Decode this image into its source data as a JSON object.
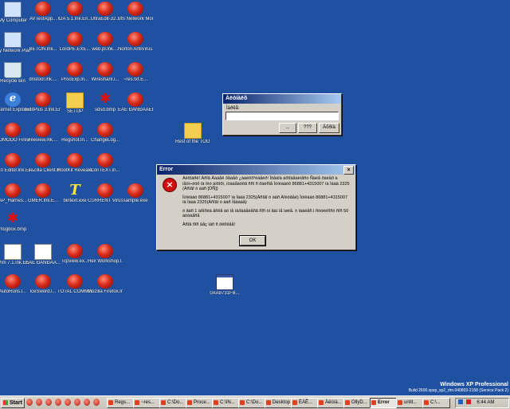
{
  "desktop": {
    "watermark": {
      "line1": "Windows XP Professional",
      "line2": "Build 2600.xpsp_sp2_rtm.040803-2158 (Service Pack 2)"
    },
    "icons": [
      {
        "name": "my-computer",
        "icon": "monitor",
        "label": "My Computer"
      },
      {
        "name": "avtestapp",
        "icon": "bug",
        "label": "AVTestApp..."
      },
      {
        "name": "ida",
        "icon": "bug",
        "label": "IDA 5.1.lnk.En..."
      },
      {
        "name": "ultraedit",
        "icon": "bug",
        "label": "UltraEdit-32..."
      },
      {
        "name": "network-monitor",
        "icon": "bug",
        "label": "MS Network Monitor 3...."
      },
      {
        "name": "my-network-places",
        "icon": "monitor",
        "label": "My Network Places"
      },
      {
        "name": "beton",
        "icon": "bug",
        "label": "BETON.lnk..."
      },
      {
        "name": "lordpe",
        "icon": "bug",
        "label": "LordPE.EXE..."
      },
      {
        "name": "webpl",
        "icon": "bug",
        "label": "web.pl.lnk...."
      },
      {
        "name": "norton",
        "icon": "bug",
        "label": "Norton AntiVirus.l..."
      },
      {
        "name": "recycle-bin",
        "icon": "bin",
        "label": "Recycle Bin"
      },
      {
        "name": "dnstool",
        "icon": "bug",
        "label": "dnstool.lnk...."
      },
      {
        "name": "procexp",
        "icon": "bug",
        "label": "ProcExp.ln..."
      },
      {
        "name": "wireshark",
        "icon": "bug",
        "label": "Wireshark.l..."
      },
      {
        "name": "res-txt",
        "icon": "bug",
        "label": "~res.txt.E..."
      },
      {
        "name": "internet-explorer",
        "icon": "ie",
        "label": "Internet Explorer"
      },
      {
        "name": "editplus",
        "icon": "bug",
        "label": "EditPlus 3.lnk.EnCY..."
      },
      {
        "name": "setup",
        "icon": "folder",
        "label": "SETUP"
      },
      {
        "name": "sdsd-bmp",
        "icon": "splat",
        "label": "sdsd.bmp"
      },
      {
        "name": "cyr-folder",
        "icon": "bug",
        "label": "ÈÀÊ ÐÀÑÐÅÄÈËÊ"
      },
      {
        "name": "comodo",
        "icon": "bug",
        "label": "COMODO Firewall.lnk...."
      },
      {
        "name": "fileview",
        "icon": "bug",
        "label": "Fileview.lnk...."
      },
      {
        "name": "regshot",
        "icon": "bug",
        "label": "Regshot.ln..."
      },
      {
        "name": "changelog",
        "icon": "bug",
        "label": "ChangeLog..."
      },
      {
        "name": "rest-of-tools",
        "icon": "folder",
        "label": "Rest of the TOOLS"
      },
      {
        "name": "editor-010",
        "icon": "bug",
        "label": "010 Editor.lnk.E..."
      },
      {
        "name": "filezilla",
        "icon": "bug",
        "label": "FileZilla Client.lnk.E..."
      },
      {
        "name": "rootkit-revealer",
        "icon": "bug",
        "label": "RootKit Revealer.ln..."
      },
      {
        "name": "context",
        "icon": "bug",
        "label": "ConTEXT.ln..."
      },
      {
        "name": "ap-harnes",
        "icon": "bug",
        "label": "AP_Harnes..."
      },
      {
        "name": "gmer",
        "icon": "bug",
        "label": "GMER.lnk.E..."
      },
      {
        "name": "bintext",
        "icon": "tbig",
        "label": "bintext.exe"
      },
      {
        "name": "current-virusdefs",
        "icon": "bug",
        "label": "CURRENT VirusDefs.l..."
      },
      {
        "name": "sample-exe",
        "icon": "bug",
        "label": "sample.exe"
      },
      {
        "name": "msgbox-bmp",
        "icon": "splat",
        "label": "msgbox.bmp"
      },
      {
        "name": "gvim",
        "icon": "doc",
        "label": "gVim 7.1.lnk.En..."
      },
      {
        "name": "cyr-file",
        "icon": "doc",
        "label": "ÈÀÊ ÐÀÑÐÅÄ..."
      },
      {
        "name": "tcpview",
        "icon": "bug",
        "label": "Tcpview.ex..."
      },
      {
        "name": "hex-workshop",
        "icon": "bug",
        "label": "Hex Workshop.l..."
      },
      {
        "name": "autoruns",
        "icon": "bug",
        "label": "AutoRuns.l..."
      },
      {
        "name": "icesword",
        "icon": "bug",
        "label": "IceSword.l..."
      },
      {
        "name": "total-commander",
        "icon": "bug",
        "label": "TOTAL COMMANDE..."
      },
      {
        "name": "mozilla-firefox",
        "icon": "bug",
        "label": "Mozilla Firefox.lnk..."
      },
      {
        "name": "file-0aa",
        "icon": "thumb",
        "label": "0AA8731FB..."
      }
    ]
  },
  "input_dialog": {
    "title": "Àëòíàëõ",
    "field_label": "Ìàðêå:",
    "field_value": "",
    "btn_browse": "...",
    "btn_help": "???",
    "btn_cancel": "Àõðìà"
  },
  "error_dialog": {
    "title": "Error",
    "close": "×",
    "para1": "Àëîõàñê! Àñîã Âàäåê ðåäåð ¿àáëõð³ëäåëõ! Ïðåäîä àðîîäåàëíåñó Ñàëå õàëåð à íåöì÷ëöõ ìà îëó àïõîðì, íóäàåäóõã ññî ñ ðàèñîå Ïóíëàäóõ 86881+4315007 íà Ìáàä 2325 (Àñîãî ò àäñ [ÒÑ])",
    "para2": "Ïóíëàäó 86881+4315007 íà Ìáàä 2325(Àñîãî ò àäñ Àîëóãåé) Ïóíëàäó 86881+4315007 íà Ìáàä 2325(Àñîãî ò àäñ Ìåäàäå)",
    "para3": "ó ãàñ 1 àõîðëä åñêå àö íå ïàðàäåëåñã ñîñ òí ãàí íå íøëå. ó íàäëåñ.ì ñòóëëîîñó ñîñ 50 àòóàåñå",
    "para4": "Àñîã ñîñ âåç ïàñ ñ ðëñêåå!",
    "ok_label": "OK"
  },
  "taskbar": {
    "start_label": "Start",
    "tasks": [
      {
        "name": "regs",
        "label": "Regs...",
        "active": false
      },
      {
        "name": "res",
        "label": "~res...",
        "active": false
      },
      {
        "name": "c-do-1",
        "label": "C:\\Do...",
        "active": false
      },
      {
        "name": "proce",
        "label": "Proce...",
        "active": false
      },
      {
        "name": "c-in",
        "label": "C:\\IN...",
        "active": false
      },
      {
        "name": "c-do-2",
        "label": "C:\\Do...",
        "active": false
      },
      {
        "name": "desktop",
        "label": "Desktop",
        "active": false
      },
      {
        "name": "cyr-task",
        "label": "ÈÀÊ...",
        "active": false
      },
      {
        "name": "alt-task",
        "label": "Àëòíà...",
        "active": false
      },
      {
        "name": "ollydbg",
        "label": "OllyD...",
        "active": false
      },
      {
        "name": "error",
        "label": "Error",
        "active": true
      },
      {
        "name": "untitled",
        "label": "untit...",
        "active": false
      },
      {
        "name": "c-last",
        "label": "C:\\...",
        "active": false
      }
    ],
    "clock": "6:44 AM"
  }
}
